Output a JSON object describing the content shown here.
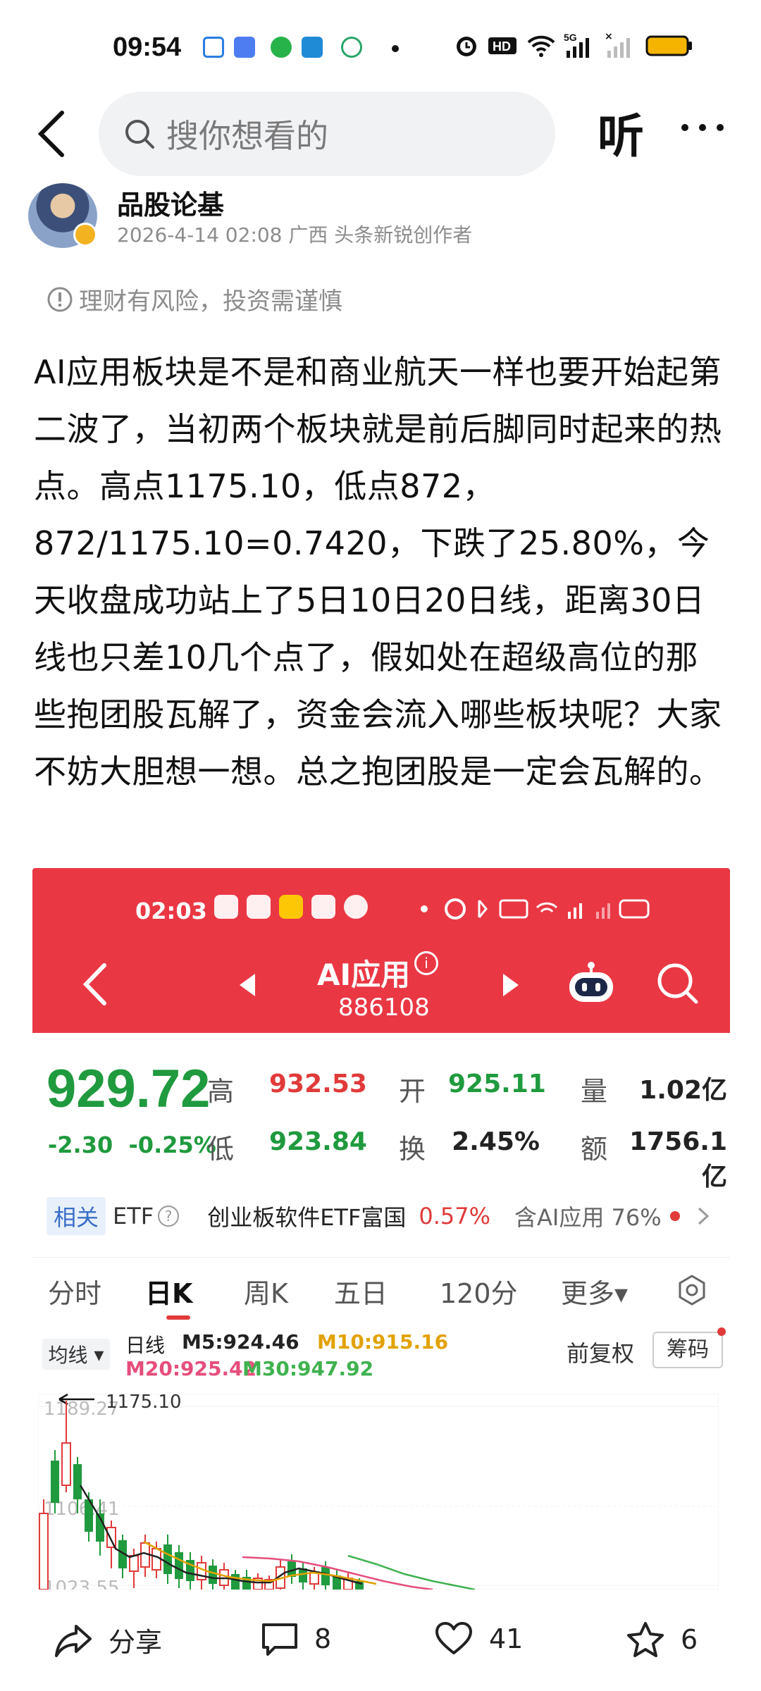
{
  "status": {
    "time": "09:54",
    "network": "5G"
  },
  "topbar": {
    "search_placeholder": "搜你想看的",
    "listen_label": "听"
  },
  "author": {
    "name": "品股论基",
    "meta": "2026-4-14 02:08  广西  头条新锐创作者",
    "avatar_text": "品股论基"
  },
  "risk_notice": "理财有风险，投资需谨慎",
  "article": {
    "text": "AI应用板块是不是和商业航天一样也要开始起第二波了，当初两个板块就是前后脚同时起来的热点。高点1175.10，低点872，872/1175.10=0.7420，下跌了25.80%，今天收盘成功站上了5日10日20日线，距离30日线也只差10几个点了，假如处在超级高位的那些抱团股瓦解了，资金会流入哪些板块呢？大家不妨大胆想一想。总之抱团股是一定会瓦解的。"
  },
  "screenshot": {
    "status_time": "02:03",
    "title": "AI应用",
    "code": "886108",
    "price": "929.72",
    "change": "-2.30",
    "change_pct": "-0.25%",
    "quote": {
      "high_label": "高",
      "high": "932.53",
      "open_label": "开",
      "open": "925.11",
      "volume_label": "量",
      "volume": "1.02亿",
      "low_label": "低",
      "low": "923.84",
      "turnover_label": "换",
      "turnover": "2.45%",
      "amount_label": "额",
      "amount": "1756.1亿"
    },
    "etf": {
      "tag": "相关",
      "etf": "ETF",
      "name": "创业板软件ETF富国",
      "pct": "0.57%",
      "ai_share": "含AI应用 76%"
    },
    "tabs": [
      "分时",
      "日K",
      "周K",
      "五日",
      "120分",
      "更多▾"
    ],
    "active_tab": "日K",
    "ma": {
      "selector": "均线",
      "period": "日线",
      "m5": "M5:924.46",
      "m10": "M10:915.16",
      "m20": "M20:925.42",
      "m30": "M30:947.92"
    },
    "adjust": "前复权",
    "chip": "筹码",
    "chart_labels": {
      "peak": "1175.10",
      "axis_top": "1189.27",
      "axis_mid": "1106.41",
      "axis_bottom": "1023.55"
    }
  },
  "actions": {
    "share": "分享",
    "comments": "8",
    "likes": "41",
    "favorites": "6"
  },
  "colors": {
    "accent_red": "#ea3744",
    "up": "#e13a3a",
    "down": "#1f9a3e"
  }
}
